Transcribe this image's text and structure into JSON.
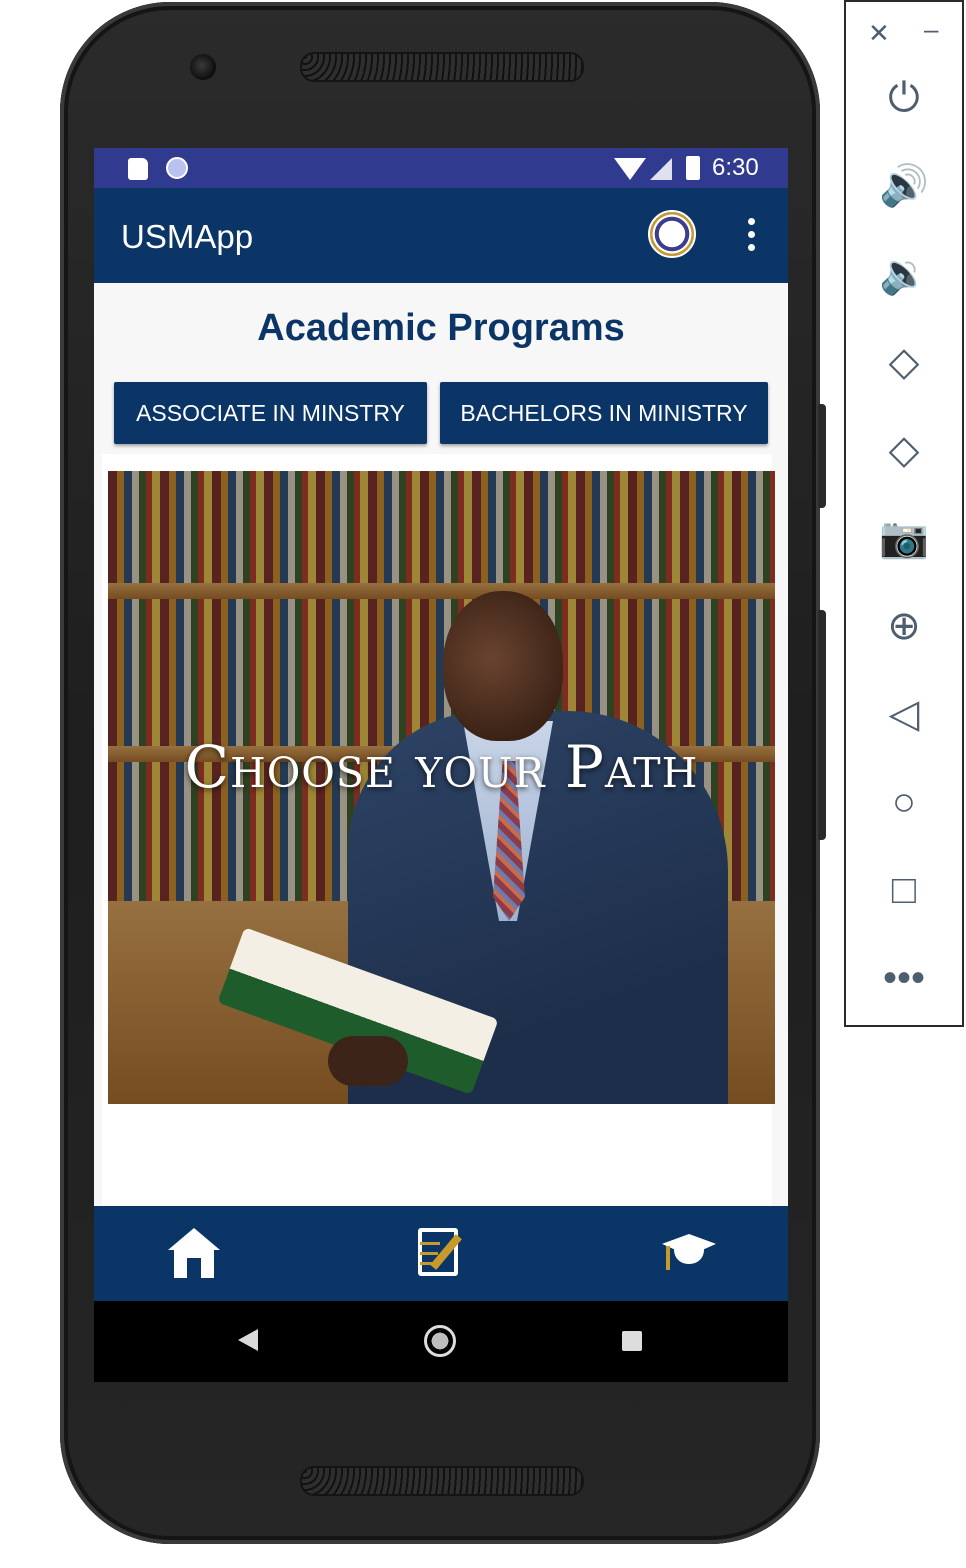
{
  "status_bar": {
    "time": "6:30",
    "icons": [
      "sd-card-icon",
      "sync-icon",
      "wifi-icon",
      "signal-icon",
      "battery-charging-icon"
    ]
  },
  "app_bar": {
    "title": "USMApp",
    "logo_icon": "usm-seal-logo",
    "menu_icon": "overflow-menu-icon"
  },
  "page": {
    "title": "Academic Programs",
    "buttons": {
      "associate": "ASSOCIATE IN MINSTRY",
      "bachelors": "BACHELORS IN MINISTRY"
    },
    "hero": {
      "caption": "Choose your Path",
      "image_subject": "student-reading-in-library"
    }
  },
  "bottom_nav": {
    "items": [
      {
        "icon": "home-icon",
        "active": true
      },
      {
        "icon": "edit-document-icon",
        "active": false
      },
      {
        "icon": "graduation-cap-icon",
        "active": false
      }
    ],
    "colors": {
      "icon_white": "#ffffff",
      "icon_gold": "#c69a2b",
      "background": "#0b3566"
    }
  },
  "system_nav": {
    "icons": [
      "back-icon",
      "home-button-icon",
      "recents-icon"
    ]
  },
  "emulator_toolbar": {
    "window_icons": [
      "close-icon",
      "minimize-icon"
    ],
    "buttons": [
      "power-icon",
      "volume-up-icon",
      "volume-down-icon",
      "rotate-left-icon",
      "rotate-right-icon",
      "screenshot-icon",
      "zoom-icon",
      "back-icon",
      "home-icon",
      "overview-icon",
      "more-icon"
    ]
  },
  "colors": {
    "status_bar": "#303a8f",
    "app_bar": "#0b3566",
    "title_text": "#0b3566",
    "button_bg": "#0b3566",
    "button_text": "#ffffff"
  }
}
